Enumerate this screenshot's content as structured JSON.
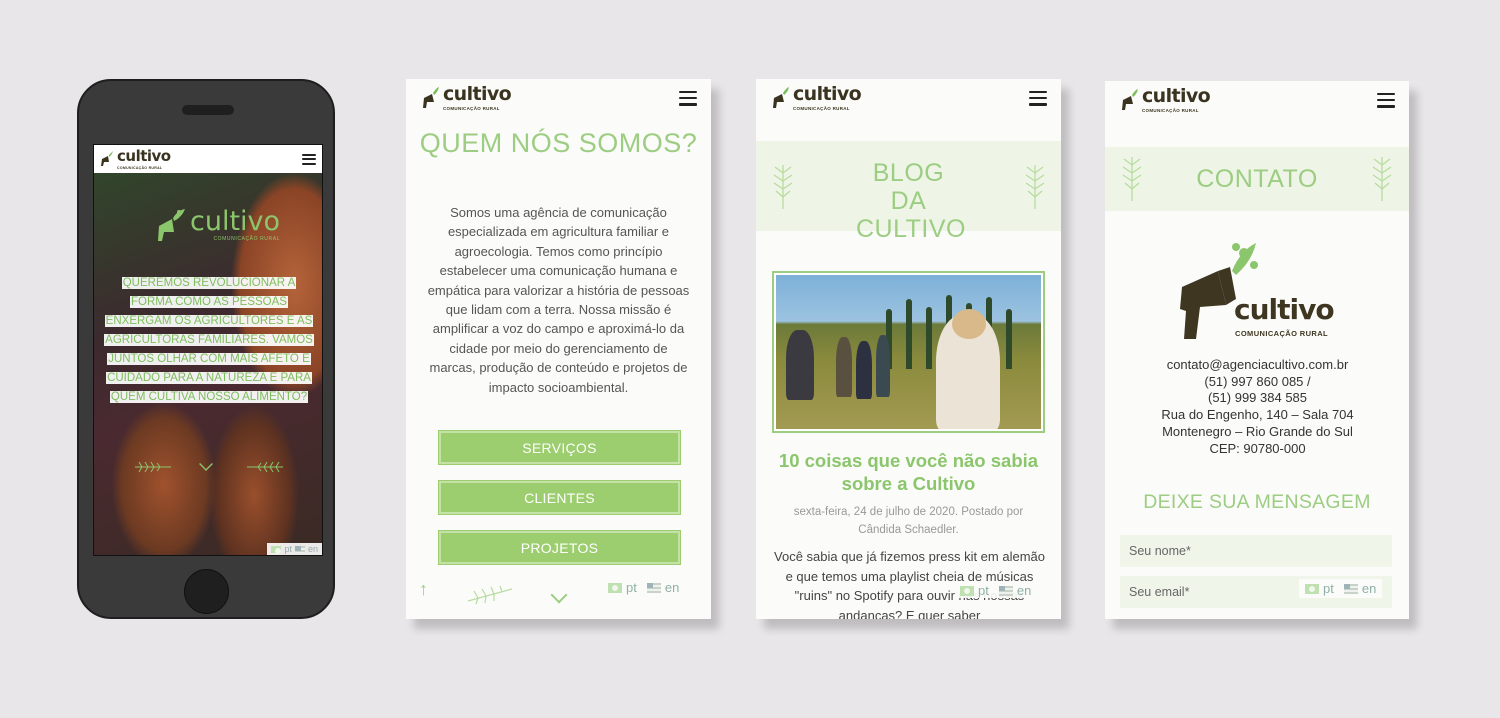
{
  "colors": {
    "accent": "#9ccd82",
    "button": "#9ccd6e",
    "logo_dark": "#3a3320",
    "background": "#e8e6e8"
  },
  "brand": {
    "name": "cultivo",
    "tagline": "COMUNICAÇÃO RURAL"
  },
  "phone": {
    "hero_text": "QUEREMOS REVOLUCIONAR A FORMA COMO AS PESSOAS ENXERGAM OS AGRICULTORES E AS AGRICULTORAS FAMILIARES. VAMOS JUNTOS OLHAR COM MAIS AFETO E CUIDADO PARA A NATUREZA E PARA QUEM CULTIVA NOSSO ALIMENTO?",
    "lang_pt": "pt",
    "lang_en": "en"
  },
  "about": {
    "title": "QUEM NÓS SOMOS?",
    "body": "Somos uma agência de comunicação especializada em agricultura familiar e agroecologia. Temos como princípio estabelecer uma comunicação humana e empática para valorizar a história de pessoas que lidam com a terra. Nossa missão é amplificar a voz do campo e aproximá-lo da cidade por meio do gerenciamento de marcas, produção de conteúdo e projetos de impacto socioambiental.",
    "buttons": [
      "SERVIÇOS",
      "CLIENTES",
      "PROJETOS"
    ],
    "lang_pt": "pt",
    "lang_en": "en"
  },
  "blog": {
    "title": "BLOG DA CULTIVO",
    "post_title": "10 coisas que você não sabia sobre a Cultivo",
    "post_meta": "sexta-feira, 24 de julho de 2020. Postado por Cândida Schaedler.",
    "excerpt": "Você sabia que já fizemos press kit em alemão e que temos uma playlist cheia de músicas \"ruins\" no Spotify para ouvir nas nossas andanças? E quer saber",
    "lang_pt": "pt",
    "lang_en": "en"
  },
  "contact": {
    "title": "CONTATO",
    "email": "contato@agenciacultivo.com.br",
    "phone1": "(51) 997 860 085 /",
    "phone2": "(51) 999 384 585",
    "address1": "Rua do Engenho, 140 – Sala 704",
    "address2": "Montenegro – Rio Grande do Sul",
    "cep": "CEP: 90780-000",
    "form_title": "DEIXE SUA MENSAGEM",
    "name_placeholder": "Seu nome*",
    "email_placeholder": "Seu email*",
    "lang_pt": "pt",
    "lang_en": "en"
  }
}
